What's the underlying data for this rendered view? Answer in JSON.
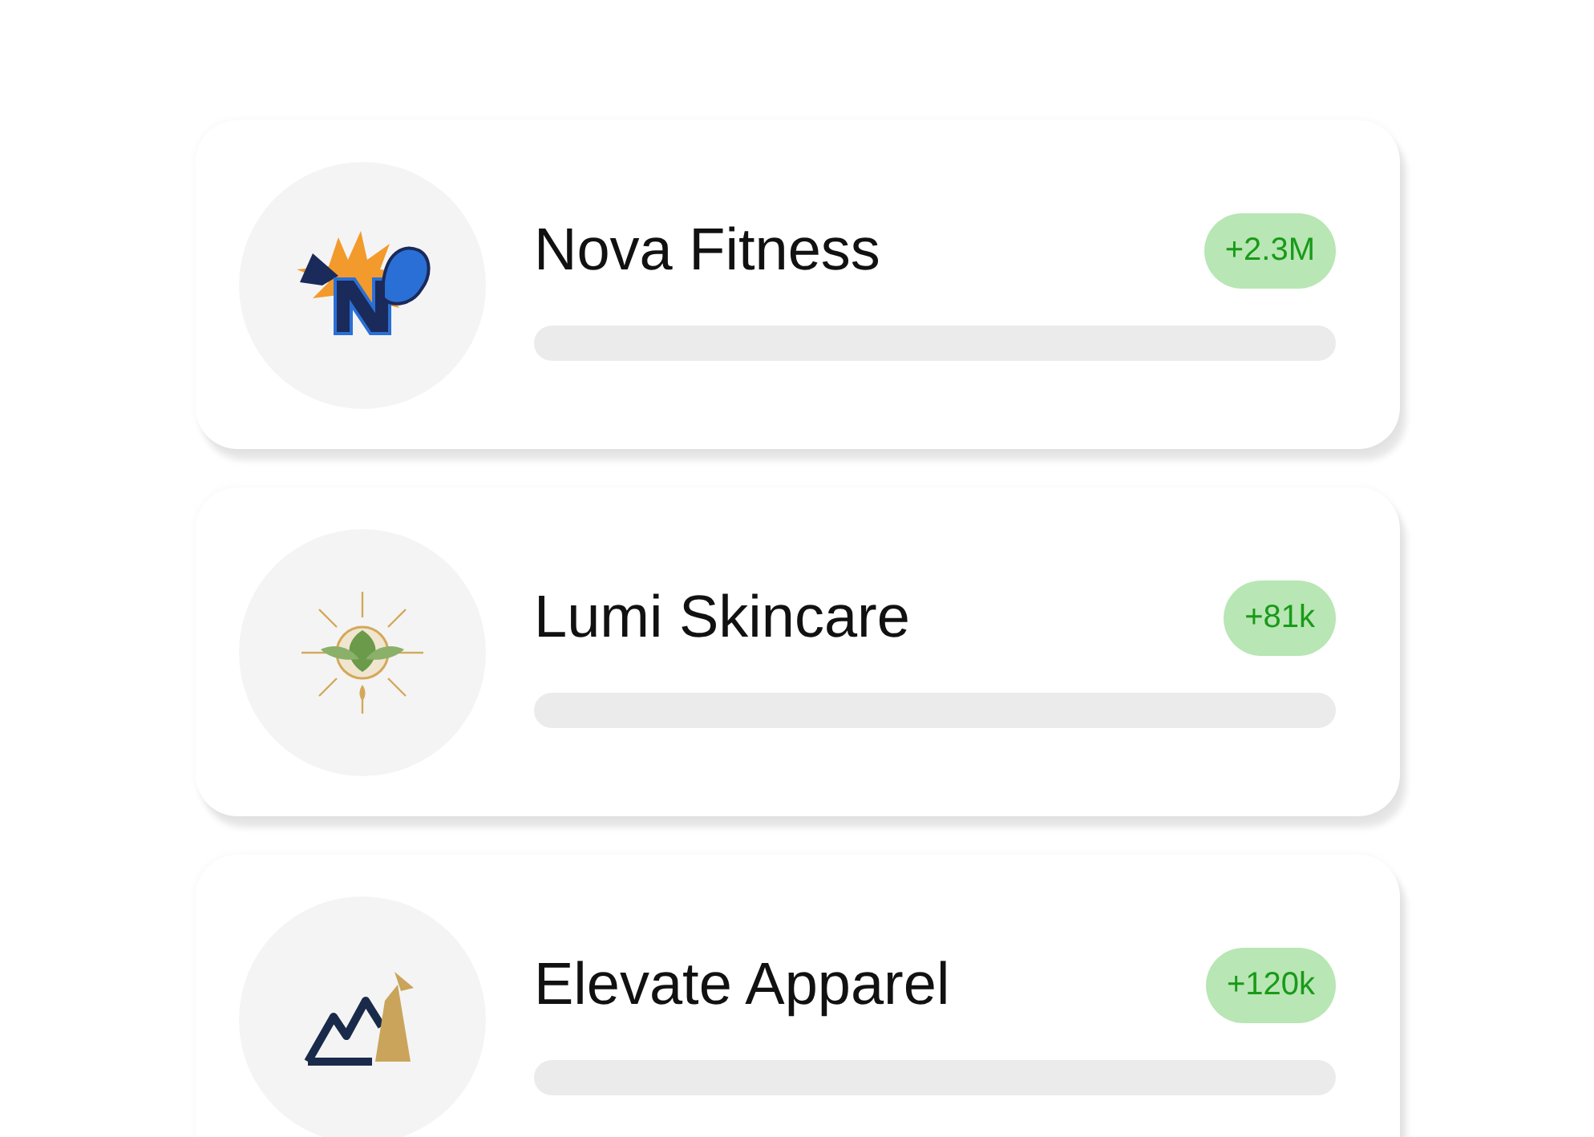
{
  "brands": [
    {
      "kind": "fitness",
      "name": "Nova Fitness",
      "growth": "+2.3M"
    },
    {
      "kind": "skincare",
      "name": "Lumi Skincare",
      "growth": "+81k"
    },
    {
      "kind": "apparel",
      "name": "Elevate Apparel",
      "growth": "+120k"
    }
  ]
}
